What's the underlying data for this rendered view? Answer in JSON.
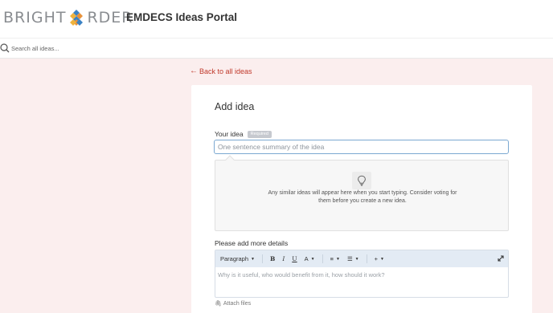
{
  "header": {
    "logo_left": "BRIGHT",
    "logo_right": "RDER",
    "portal_title": "EMDECS Ideas Portal"
  },
  "search": {
    "placeholder": "Search all ideas...",
    "icon": "search-icon"
  },
  "nav": {
    "back_label": "Back to all ideas"
  },
  "form": {
    "title": "Add idea",
    "idea_label": "Your idea",
    "required_badge": "Required",
    "idea_placeholder": "One sentence summary of the idea",
    "similar_text": "Any similar ideas will appear here when you start typing. Consider voting for them before you create a new idea.",
    "details_label": "Please add more details",
    "details_placeholder": "Why is it useful, who would benefit from it, how should it work?",
    "attach_label": "Attach files"
  },
  "toolbar": {
    "paragraph": "Paragraph",
    "bold": "B",
    "italic": "I",
    "underline": "U",
    "text_color": "A",
    "align": "≡",
    "list": "☰",
    "insert": "+"
  },
  "colors": {
    "accent": "#c0392b",
    "page_bg": "#fbeeee",
    "input_focus": "#7ba8d1",
    "toolbar_bg": "#e3ebf4"
  }
}
